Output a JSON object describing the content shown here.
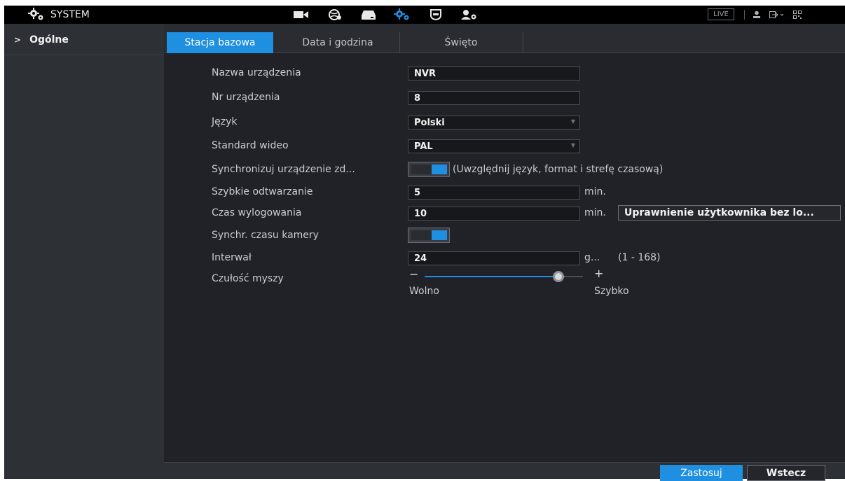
{
  "app": {
    "title": "SYSTEM",
    "live_label": "LIVE"
  },
  "nav_icons": [
    "camera-icon",
    "network-icon",
    "storage-icon",
    "system-settings-icon",
    "security-icon",
    "account-icon"
  ],
  "sidebar": {
    "items": [
      {
        "label": "Ogólne",
        "chevron": ">"
      }
    ]
  },
  "tabs": [
    {
      "label": "Stacja bazowa",
      "active": true
    },
    {
      "label": "Data i godzina",
      "active": false
    },
    {
      "label": "Święto",
      "active": false
    }
  ],
  "form": {
    "device_name": {
      "label": "Nazwa urządzenia",
      "value": "NVR"
    },
    "device_no": {
      "label": "Nr urządzenia",
      "value": "8"
    },
    "language": {
      "label": "Język",
      "value": "Polski"
    },
    "video_standard": {
      "label": "Standard wideo",
      "value": "PAL"
    },
    "sync_device": {
      "label": "Synchronizuj urządzenie zd...",
      "note": "(Uwzględnij język, format i strefę czasową)",
      "enabled": true
    },
    "quick_playback": {
      "label": "Szybkie odtwarzanie",
      "value": "5",
      "unit": "min."
    },
    "logout_time": {
      "label": "Czas wylogowania",
      "value": "10",
      "unit": "min.",
      "button": "Uprawnienie użytkownika bez lo..."
    },
    "camera_time_sync": {
      "label": "Synchr. czasu kamery",
      "enabled": true
    },
    "interval": {
      "label": "Interwał",
      "value": "24",
      "unit": "g...",
      "range": "(1 - 168)"
    },
    "mouse_sensitivity": {
      "label": "Czułość myszy",
      "minus": "−",
      "plus": "+",
      "slow": "Wolno",
      "fast": "Szybko",
      "level": 0.9
    }
  },
  "buttons": {
    "apply": "Zastosuj",
    "back": "Wstecz"
  },
  "colors": {
    "accent": "#1e8fe1",
    "background": "#202227",
    "topbar": "#000000"
  }
}
